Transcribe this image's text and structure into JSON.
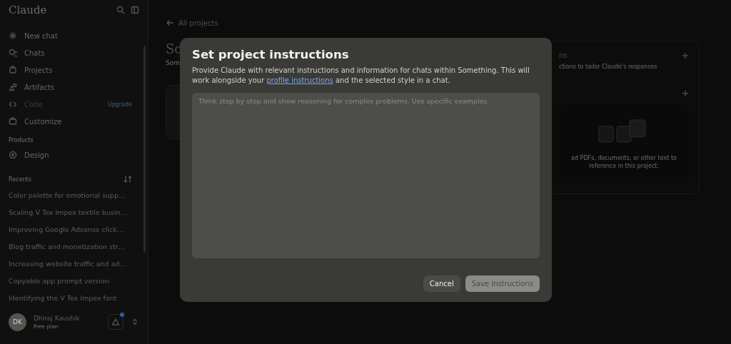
{
  "sidebar": {
    "logo": "Claude",
    "nav": [
      {
        "label": "New chat",
        "kind": "plus",
        "disabled": false
      },
      {
        "label": "Chats",
        "kind": "chats",
        "disabled": false
      },
      {
        "label": "Projects",
        "kind": "projects",
        "disabled": false
      },
      {
        "label": "Artifacts",
        "kind": "artifacts",
        "disabled": false
      },
      {
        "label": "Code",
        "kind": "code",
        "disabled": true,
        "badge": "Upgrade"
      },
      {
        "label": "Customize",
        "kind": "customize",
        "disabled": false
      }
    ],
    "products_heading": "Products",
    "products": [
      {
        "label": "Design"
      }
    ],
    "recents_heading": "Recents",
    "recents": [
      "Color palette for emotional supp…",
      "Scaling V Tex Impex textile busin…",
      "Improving Google Adsense click…",
      "Blog traffic and monetization str…",
      "Increasing website traffic and ad…",
      "Copyable app prompt version",
      "Identifying the V Tex Impex font"
    ],
    "user": {
      "initials": "DK",
      "name": "Dhiraj Kaushik",
      "plan": "Free plan",
      "notification": true
    }
  },
  "project": {
    "back_link": "All projects",
    "title": "So",
    "subtitle": "Som",
    "instructions_card": {
      "heading": "ns",
      "description": "ctions to tailor Claude's responses"
    },
    "files_card": {
      "upload_hint_1": "ad PDFs, documents, or other text to",
      "upload_hint_2": "reference in this project."
    }
  },
  "dialog": {
    "title": "Set project instructions",
    "description_before": "Provide Claude with relevant instructions and information for chats within Something. This will work alongside your ",
    "link": "profile instructions",
    "description_after": " and the selected style in a chat.",
    "placeholder": "Think step by step and show reasoning for complex problems. Use specific examples.",
    "buttons": [
      {
        "label": "Cancel",
        "kind": "secondary",
        "disabled": false
      },
      {
        "label": "Save instructions",
        "kind": "primary",
        "disabled": true
      }
    ]
  }
}
